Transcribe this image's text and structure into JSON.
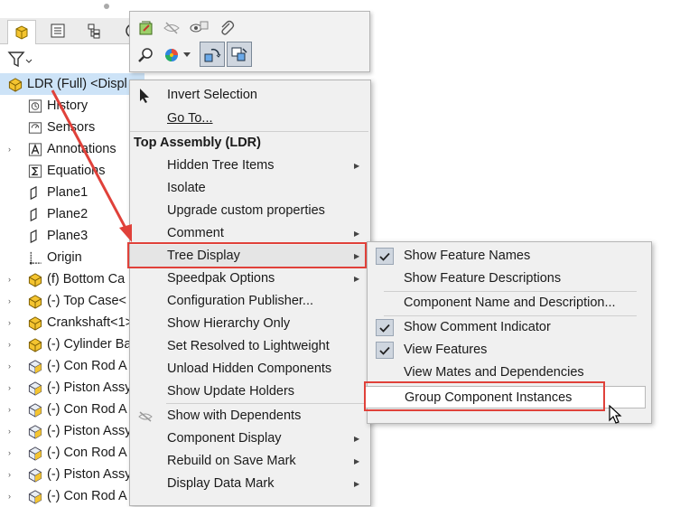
{
  "feature_tree": {
    "tabs": [
      {
        "name": "feature-manager-tab",
        "icon": "feature-manager-icon"
      },
      {
        "name": "property-manager-tab",
        "icon": "property-manager-icon"
      },
      {
        "name": "configuration-manager-tab",
        "icon": "configuration-manager-icon"
      },
      {
        "name": "dimxpert-tab",
        "icon": "target-icon"
      }
    ],
    "filter_icon": "filter-icon",
    "items": [
      {
        "label": "LDR (Full) <Displ",
        "icon": "assembly-icon",
        "caret": ""
      },
      {
        "label": "History",
        "icon": "history-icon",
        "caret": ""
      },
      {
        "label": "Sensors",
        "icon": "sensor-icon",
        "caret": ""
      },
      {
        "label": "Annotations",
        "icon": "annotation-icon",
        "caret": "›"
      },
      {
        "label": "Equations",
        "icon": "equation-icon",
        "caret": ""
      },
      {
        "label": "Plane1",
        "icon": "plane-icon",
        "caret": ""
      },
      {
        "label": "Plane2",
        "icon": "plane-icon",
        "caret": ""
      },
      {
        "label": "Plane3",
        "icon": "plane-icon",
        "caret": ""
      },
      {
        "label": "Origin",
        "icon": "origin-icon",
        "caret": ""
      },
      {
        "label": "(f) Bottom Ca",
        "icon": "subassembly-icon",
        "caret": "›"
      },
      {
        "label": "(-) Top Case<",
        "icon": "subassembly-icon",
        "caret": "›"
      },
      {
        "label": "Crankshaft<1>",
        "icon": "subassembly-icon",
        "caret": "›"
      },
      {
        "label": "(-) Cylinder Ba",
        "icon": "subassembly-icon",
        "caret": "›"
      },
      {
        "label": "(-) Con Rod A",
        "icon": "part-icon",
        "caret": "›"
      },
      {
        "label": "(-) Piston Assy",
        "icon": "part-icon",
        "caret": "›"
      },
      {
        "label": "(-) Con Rod A",
        "icon": "part-icon",
        "caret": "›"
      },
      {
        "label": "(-) Piston Assy",
        "icon": "part-icon",
        "caret": "›"
      },
      {
        "label": "(-) Con Rod A",
        "icon": "part-icon",
        "caret": "›"
      },
      {
        "label": "(-) Piston Assy",
        "icon": "part-icon",
        "caret": "›"
      },
      {
        "label": "(-) Con Rod A",
        "icon": "part-icon",
        "caret": "›"
      }
    ]
  },
  "context_toolbar": {
    "buttons": [
      {
        "icon": "edit-component-icon"
      },
      {
        "icon": "hide-icon"
      },
      {
        "icon": "isolate-icon"
      },
      {
        "icon": "paperclip-icon"
      },
      {
        "icon": "zoom-to-selection-icon"
      },
      {
        "icon": "appearance-icon"
      },
      {
        "icon": "dropdown-arrow-icon"
      },
      {
        "icon": "rotate-component-icon"
      },
      {
        "icon": "move-component-icon"
      }
    ]
  },
  "context_menu": {
    "invert_selection": "Invert Selection",
    "go_to": "Go To...",
    "section_header": "Top Assembly (LDR)",
    "items": [
      {
        "label": "Hidden Tree Items",
        "submenu": true
      },
      {
        "label": "Isolate",
        "submenu": false
      },
      {
        "label": "Upgrade custom properties",
        "submenu": false
      },
      {
        "label": "Comment",
        "submenu": true
      },
      {
        "label": "Tree Display",
        "submenu": true
      },
      {
        "label": "Speedpak Options",
        "submenu": true
      },
      {
        "label": "Configuration Publisher...",
        "submenu": false
      },
      {
        "label": "Show Hierarchy Only",
        "submenu": false
      },
      {
        "label": "Set Resolved to Lightweight",
        "submenu": false
      },
      {
        "label": "Unload Hidden Components",
        "submenu": false
      },
      {
        "label": "Show Update Holders",
        "submenu": false
      }
    ],
    "lower_items": [
      {
        "label": "Show with Dependents",
        "submenu": false
      },
      {
        "label": "Component Display",
        "submenu": true
      },
      {
        "label": "Rebuild on Save Mark",
        "submenu": true
      },
      {
        "label": "Display Data Mark",
        "submenu": true
      }
    ]
  },
  "tree_display_submenu": {
    "items": [
      {
        "label": "Show Feature Names",
        "checked": true
      },
      {
        "label": "Show Feature Descriptions",
        "checked": false
      },
      {
        "label": "Component Name and Description...",
        "checked": false
      },
      {
        "label": "Show Comment Indicator",
        "checked": true
      },
      {
        "label": "View Features",
        "checked": true
      },
      {
        "label": "View Mates and Dependencies",
        "checked": false
      },
      {
        "label": "Group Component Instances",
        "checked": false
      }
    ]
  },
  "annotation": {
    "highlight_color": "#e0413a",
    "highlighted_items": [
      "Tree Display",
      "Group Component Instances"
    ]
  }
}
